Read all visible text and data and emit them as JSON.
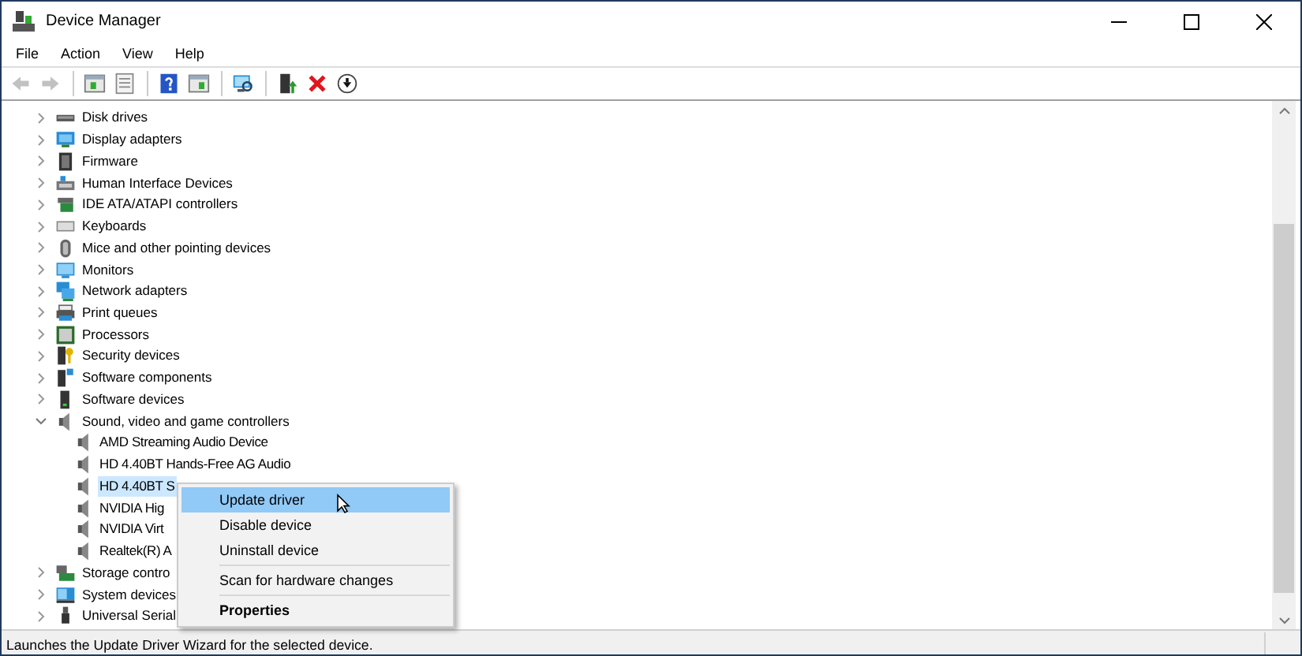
{
  "window": {
    "title": "Device Manager"
  },
  "menu_bar": [
    {
      "label": "File"
    },
    {
      "label": "Action"
    },
    {
      "label": "View"
    },
    {
      "label": "Help"
    }
  ],
  "toolbar": [
    {
      "kind": "back",
      "disabled": true
    },
    {
      "kind": "forward",
      "disabled": true
    },
    {
      "kind": "separator"
    },
    {
      "kind": "console-tree",
      "disabled": false
    },
    {
      "kind": "properties",
      "disabled": false
    },
    {
      "kind": "separator"
    },
    {
      "kind": "help",
      "disabled": false
    },
    {
      "kind": "action-pane",
      "disabled": false
    },
    {
      "kind": "separator"
    },
    {
      "kind": "scan",
      "disabled": false
    },
    {
      "kind": "separator"
    },
    {
      "kind": "update",
      "disabled": false
    },
    {
      "kind": "uninstall",
      "disabled": false
    },
    {
      "kind": "disable",
      "disabled": false
    }
  ],
  "tree": {
    "items": [
      {
        "label": "Disk drives",
        "kind": "disk",
        "expanded": false
      },
      {
        "label": "Display adapters",
        "kind": "display",
        "expanded": false
      },
      {
        "label": "Firmware",
        "kind": "firmware",
        "expanded": false
      },
      {
        "label": "Human Interface Devices",
        "kind": "hid",
        "expanded": false
      },
      {
        "label": "IDE ATA/ATAPI controllers",
        "kind": "ide",
        "expanded": false
      },
      {
        "label": "Keyboards",
        "kind": "keyboard",
        "expanded": false
      },
      {
        "label": "Mice and other pointing devices",
        "kind": "mouse",
        "expanded": false
      },
      {
        "label": "Monitors",
        "kind": "monitor",
        "expanded": false
      },
      {
        "label": "Network adapters",
        "kind": "network",
        "expanded": false
      },
      {
        "label": "Print queues",
        "kind": "printer",
        "expanded": false
      },
      {
        "label": "Processors",
        "kind": "processor",
        "expanded": false
      },
      {
        "label": "Security devices",
        "kind": "security",
        "expanded": false
      },
      {
        "label": "Software components",
        "kind": "component",
        "expanded": false
      },
      {
        "label": "Software devices",
        "kind": "software",
        "expanded": false
      },
      {
        "label": "Sound, video and game controllers",
        "kind": "speaker",
        "expanded": true,
        "children": [
          {
            "label": "AMD Streaming Audio Device",
            "selected": false
          },
          {
            "label": "HD 4.40BT Hands-Free AG Audio",
            "selected": false
          },
          {
            "label": "HD 4.40BT S",
            "selected": true
          },
          {
            "label": "NVIDIA Hig",
            "selected": false
          },
          {
            "label": "NVIDIA Virt",
            "selected": false
          },
          {
            "label": "Realtek(R) A",
            "selected": false
          }
        ]
      },
      {
        "label": "Storage contro",
        "kind": "storage",
        "expanded": false
      },
      {
        "label": "System devices",
        "kind": "system",
        "expanded": false
      },
      {
        "label": "Universal Serial",
        "kind": "usb",
        "expanded": false
      }
    ]
  },
  "context_menu": {
    "items": [
      {
        "kind": "item",
        "label": "Update driver",
        "selected": true,
        "default": false
      },
      {
        "kind": "item",
        "label": "Disable device",
        "selected": false,
        "default": false
      },
      {
        "kind": "item",
        "label": "Uninstall device",
        "selected": false,
        "default": false
      },
      {
        "kind": "separator"
      },
      {
        "kind": "item",
        "label": "Scan for hardware changes",
        "selected": false,
        "default": false
      },
      {
        "kind": "separator"
      },
      {
        "kind": "item",
        "label": "Properties",
        "selected": false,
        "default": true
      }
    ]
  },
  "status_bar": {
    "text": "Launches the Update Driver Wizard for the selected device."
  }
}
